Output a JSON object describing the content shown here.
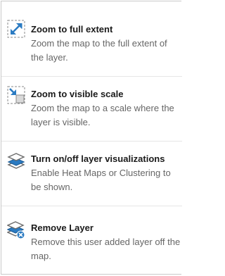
{
  "menu": {
    "items": [
      {
        "icon": "zoom-full-extent-icon",
        "title": "Zoom to full extent",
        "description": "Zoom the map to the full extent of the layer."
      },
      {
        "icon": "zoom-visible-scale-icon",
        "title": "Zoom to visible scale",
        "description": "Zoom the map to a scale where the layer is visible."
      },
      {
        "icon": "layer-visualizations-icon",
        "title": "Turn on/off layer visualizations",
        "description": "Enable Heat Maps or Clustering to be shown."
      },
      {
        "icon": "remove-layer-icon",
        "title": "Remove Layer",
        "description": "Remove this user added layer off the map."
      }
    ]
  },
  "colors": {
    "accent_blue": "#2b7bc2",
    "title_text": "#1a1a1a",
    "description_text": "#666666",
    "border": "#c9c9c9"
  }
}
